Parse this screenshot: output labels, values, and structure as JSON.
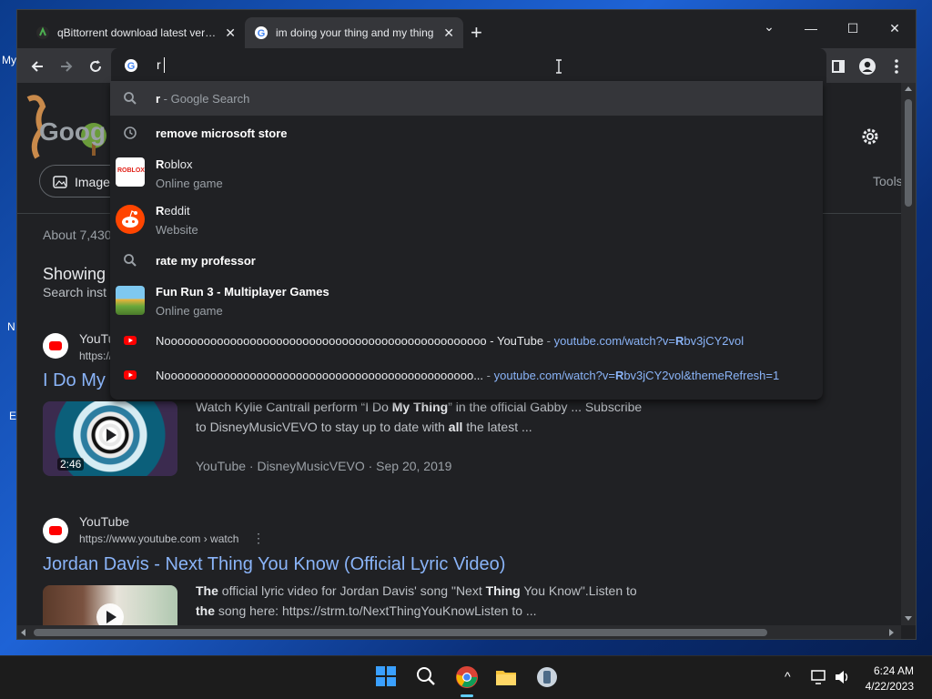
{
  "desktop": {
    "labels": [
      "My",
      "N",
      "E"
    ]
  },
  "tabs": [
    {
      "title": "qBittorrent download latest version",
      "close": "✕"
    },
    {
      "title": "im doing your thing and my thing",
      "close": "✕"
    }
  ],
  "new_tab_label": "+",
  "window_controls": {
    "dropdown": "⌄",
    "minimize": "—",
    "maximize": "☐",
    "close": "✕"
  },
  "omnibox": {
    "value": "r"
  },
  "dropdown": {
    "suggestions": [
      {
        "type": "search",
        "bold": "r",
        "text": " - Google Search"
      },
      {
        "type": "history",
        "bold": "remove microsoft store"
      },
      {
        "type": "entity",
        "bold": "R",
        "rest": "oblox",
        "sub": "Online game",
        "img_text": "ROBLOX"
      },
      {
        "type": "entity",
        "bold": "R",
        "rest": "eddit",
        "sub": "Website"
      },
      {
        "type": "search",
        "bold": "rate my professor"
      },
      {
        "type": "entity",
        "bold": "Fun Run 3 - Multiplayer Games",
        "sub": "Online game"
      },
      {
        "type": "youtube",
        "text": "Nooooooooooooooooooooooooooooooooooooooooooooooooo - YouTube",
        "sep": " - ",
        "link_pre": "youtube.com/watch?v=",
        "link_bold": "R",
        "link_post": "bv3jCY2vol"
      },
      {
        "type": "youtube",
        "text": "Nooooooooooooooooooooooooooooooooooooooooooooooo...",
        "sep": " - ",
        "link_pre": "youtube.com/watch?v=",
        "link_bold": "R",
        "link_post": "bv3jCY2vol&themeRefresh=1"
      }
    ]
  },
  "page": {
    "logo_text": "Goog",
    "images_chip": "Images",
    "tools": "Tools",
    "result_count": "About 7,430",
    "showing": "Showing",
    "search_instead": "Search inst",
    "result1": {
      "site": "YouTu",
      "url": "https://",
      "title": "I Do My",
      "snippet_line1_pre": "Watch Kylie Cantrall perform “I Do ",
      "snippet_line1_bold": "My Thing",
      "snippet_line1_post": "” in the official Gabby ... Subscribe",
      "snippet_line2_pre": "to DisneyMusicVEVO to stay up to date with ",
      "snippet_line2_bold": "all",
      "snippet_line2_post": " the latest ...",
      "meta": "YouTube · DisneyMusicVEVO · Sep 20, 2019",
      "duration": "2:46"
    },
    "result2": {
      "site": "YouTube",
      "url": "https://www.youtube.com › watch",
      "menu": "⋮",
      "title": "Jordan Davis - Next Thing You Know (Official Lyric Video)",
      "snippet_line1_b1": "The",
      "snippet_line1_t1": " official lyric video for Jordan Davis' song \"Next ",
      "snippet_line1_b2": "Thing",
      "snippet_line1_t2": " You Know\".Listen to",
      "snippet_line2_b1": "the",
      "snippet_line2_t1": " song here: https://strm.to/NextThingYouKnowListen to ..."
    }
  },
  "taskbar": {
    "time": "6:24 AM",
    "date": "4/22/2023",
    "tray_chevron": "^"
  }
}
